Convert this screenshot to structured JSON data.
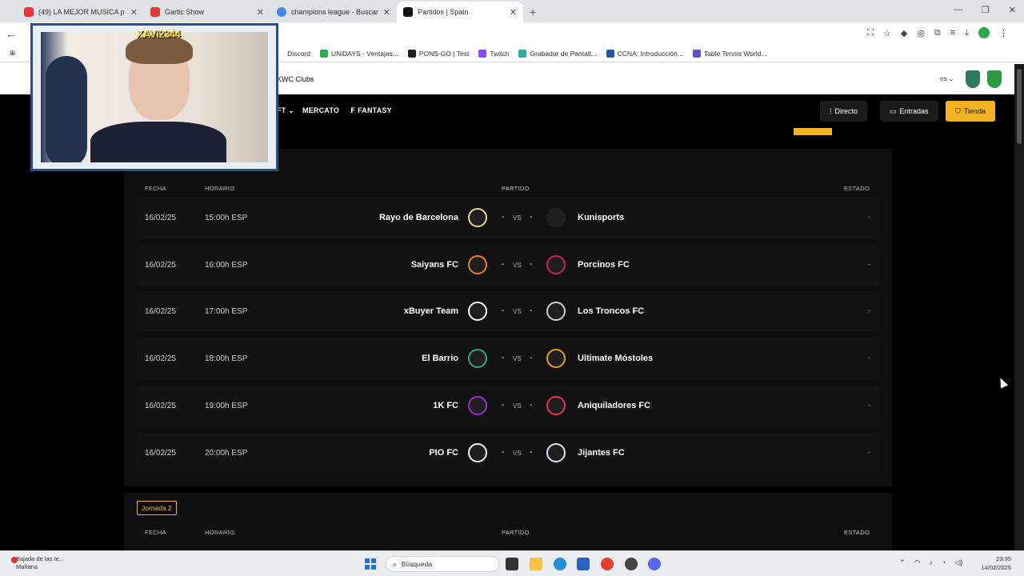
{
  "browser": {
    "tabs": [
      {
        "label": "(49) LA MEJOR MUSICA p",
        "fav_color": "#e53935",
        "active": false
      },
      {
        "label": "Gartic Show",
        "fav_color": "#e53935",
        "active": false
      },
      {
        "label": "champions league - Buscar con",
        "fav_color": "#4285f4",
        "active": false
      },
      {
        "label": "Partidos | Spain",
        "fav_color": "#111111",
        "active": true
      }
    ],
    "new_tab": "+",
    "bookmarks": [
      {
        "label": "Discord",
        "color": "#5865f2"
      },
      {
        "label": "UNiDAYS - Ventajas...",
        "color": "#25b14b"
      },
      {
        "label": "PONS-GO | Test",
        "color": "#222222"
      },
      {
        "label": "Twitch",
        "color": "#9146ff"
      },
      {
        "label": "Grabador de Pantall...",
        "color": "#2ab0a0"
      },
      {
        "label": "CCNA: Introducción...",
        "color": "#1f5aa6"
      },
      {
        "label": "Table Tennis World...",
        "color": "#6b4bd3"
      }
    ]
  },
  "site": {
    "top_link": "KWC Clubs",
    "lang": "es",
    "nav": {
      "partial_item": "FT",
      "mercato": "MERCATO",
      "fantasy": "FANTASY",
      "directo": "Directo",
      "entradas": "Entradas",
      "tienda": "Tienda"
    }
  },
  "table": {
    "headers": {
      "fecha": "FECHA",
      "horario": "HORARIO",
      "partido": "PARTIDO",
      "estado": "ESTADO"
    },
    "vs_label": "VS",
    "matches": [
      {
        "fecha": "16/02/25",
        "horario": "15:00h ESP",
        "home": "Rayo de Barcelona",
        "home_color": "#e8d5a0",
        "away": "Kunisports",
        "away_color": "#2a1a2a",
        "home_score": "-",
        "away_score": "-",
        "estado": "-"
      },
      {
        "fecha": "16/02/25",
        "horario": "16:00h ESP",
        "home": "Saiyans FC",
        "home_color": "#f0801a",
        "away": "Porcinos FC",
        "away_color": "#c8235a",
        "home_score": "-",
        "away_score": "-",
        "estado": "-"
      },
      {
        "fecha": "16/02/25",
        "horario": "17:00h ESP",
        "home": "xBuyer Team",
        "home_color": "#ffffff",
        "away": "Los Troncos FC",
        "away_color": "#cfcfcf",
        "home_score": "-",
        "away_score": "-",
        "estado": "-"
      },
      {
        "fecha": "16/02/25",
        "horario": "18:00h ESP",
        "home": "El Barrio",
        "home_color": "#2fa88a",
        "away": "Ultimate Móstoles",
        "away_color": "#e0a030",
        "home_score": "-",
        "away_score": "-",
        "estado": "-"
      },
      {
        "fecha": "16/02/25",
        "horario": "19:00h ESP",
        "home": "1K FC",
        "home_color": "#a02cc8",
        "away": "Aniquiladores FC",
        "away_color": "#e23a4a",
        "home_score": "-",
        "away_score": "-",
        "estado": "-"
      },
      {
        "fecha": "16/02/25",
        "horario": "20:00h ESP",
        "home": "PIO FC",
        "home_color": "#f5f5f5",
        "away": "Jijantes FC",
        "away_color": "#e0e0f0",
        "home_score": "-",
        "away_score": "-",
        "estado": "-"
      }
    ],
    "jornada_label": "Jornada 2"
  },
  "webcam": {
    "name": "XAVI2344"
  },
  "taskbar": {
    "weather_line1": "Bajada de las te...",
    "weather_line2": "Mañana",
    "search_placeholder": "Búsqueda",
    "time": "23:35",
    "date": "14/02/2025"
  },
  "colors": {
    "accent": "#f2b323",
    "panel": "#0f0f0f"
  }
}
